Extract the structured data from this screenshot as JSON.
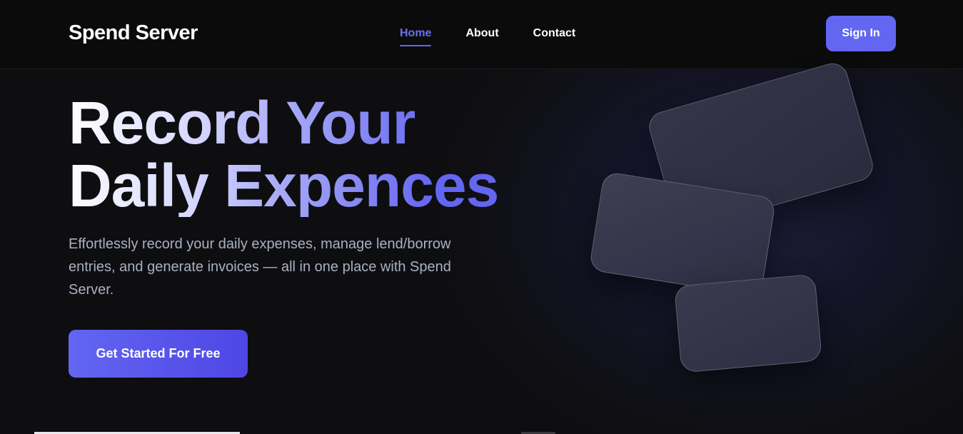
{
  "header": {
    "brand": "Spend Server",
    "nav": [
      {
        "label": "Home",
        "active": true
      },
      {
        "label": "About",
        "active": false
      },
      {
        "label": "Contact",
        "active": false
      }
    ],
    "signin_label": "Sign In"
  },
  "hero": {
    "title_line1": "Record Your",
    "title_line2": "Daily Expences",
    "subtitle": "Effortlessly record your daily expenses, manage lend/borrow entries, and generate invoices — all in one place with Spend Server.",
    "cta_label": "Get Started For Free"
  },
  "colors": {
    "accent": "#6366f1",
    "background": "#0e0e10",
    "subtitle_text": "#a9b0c3"
  }
}
